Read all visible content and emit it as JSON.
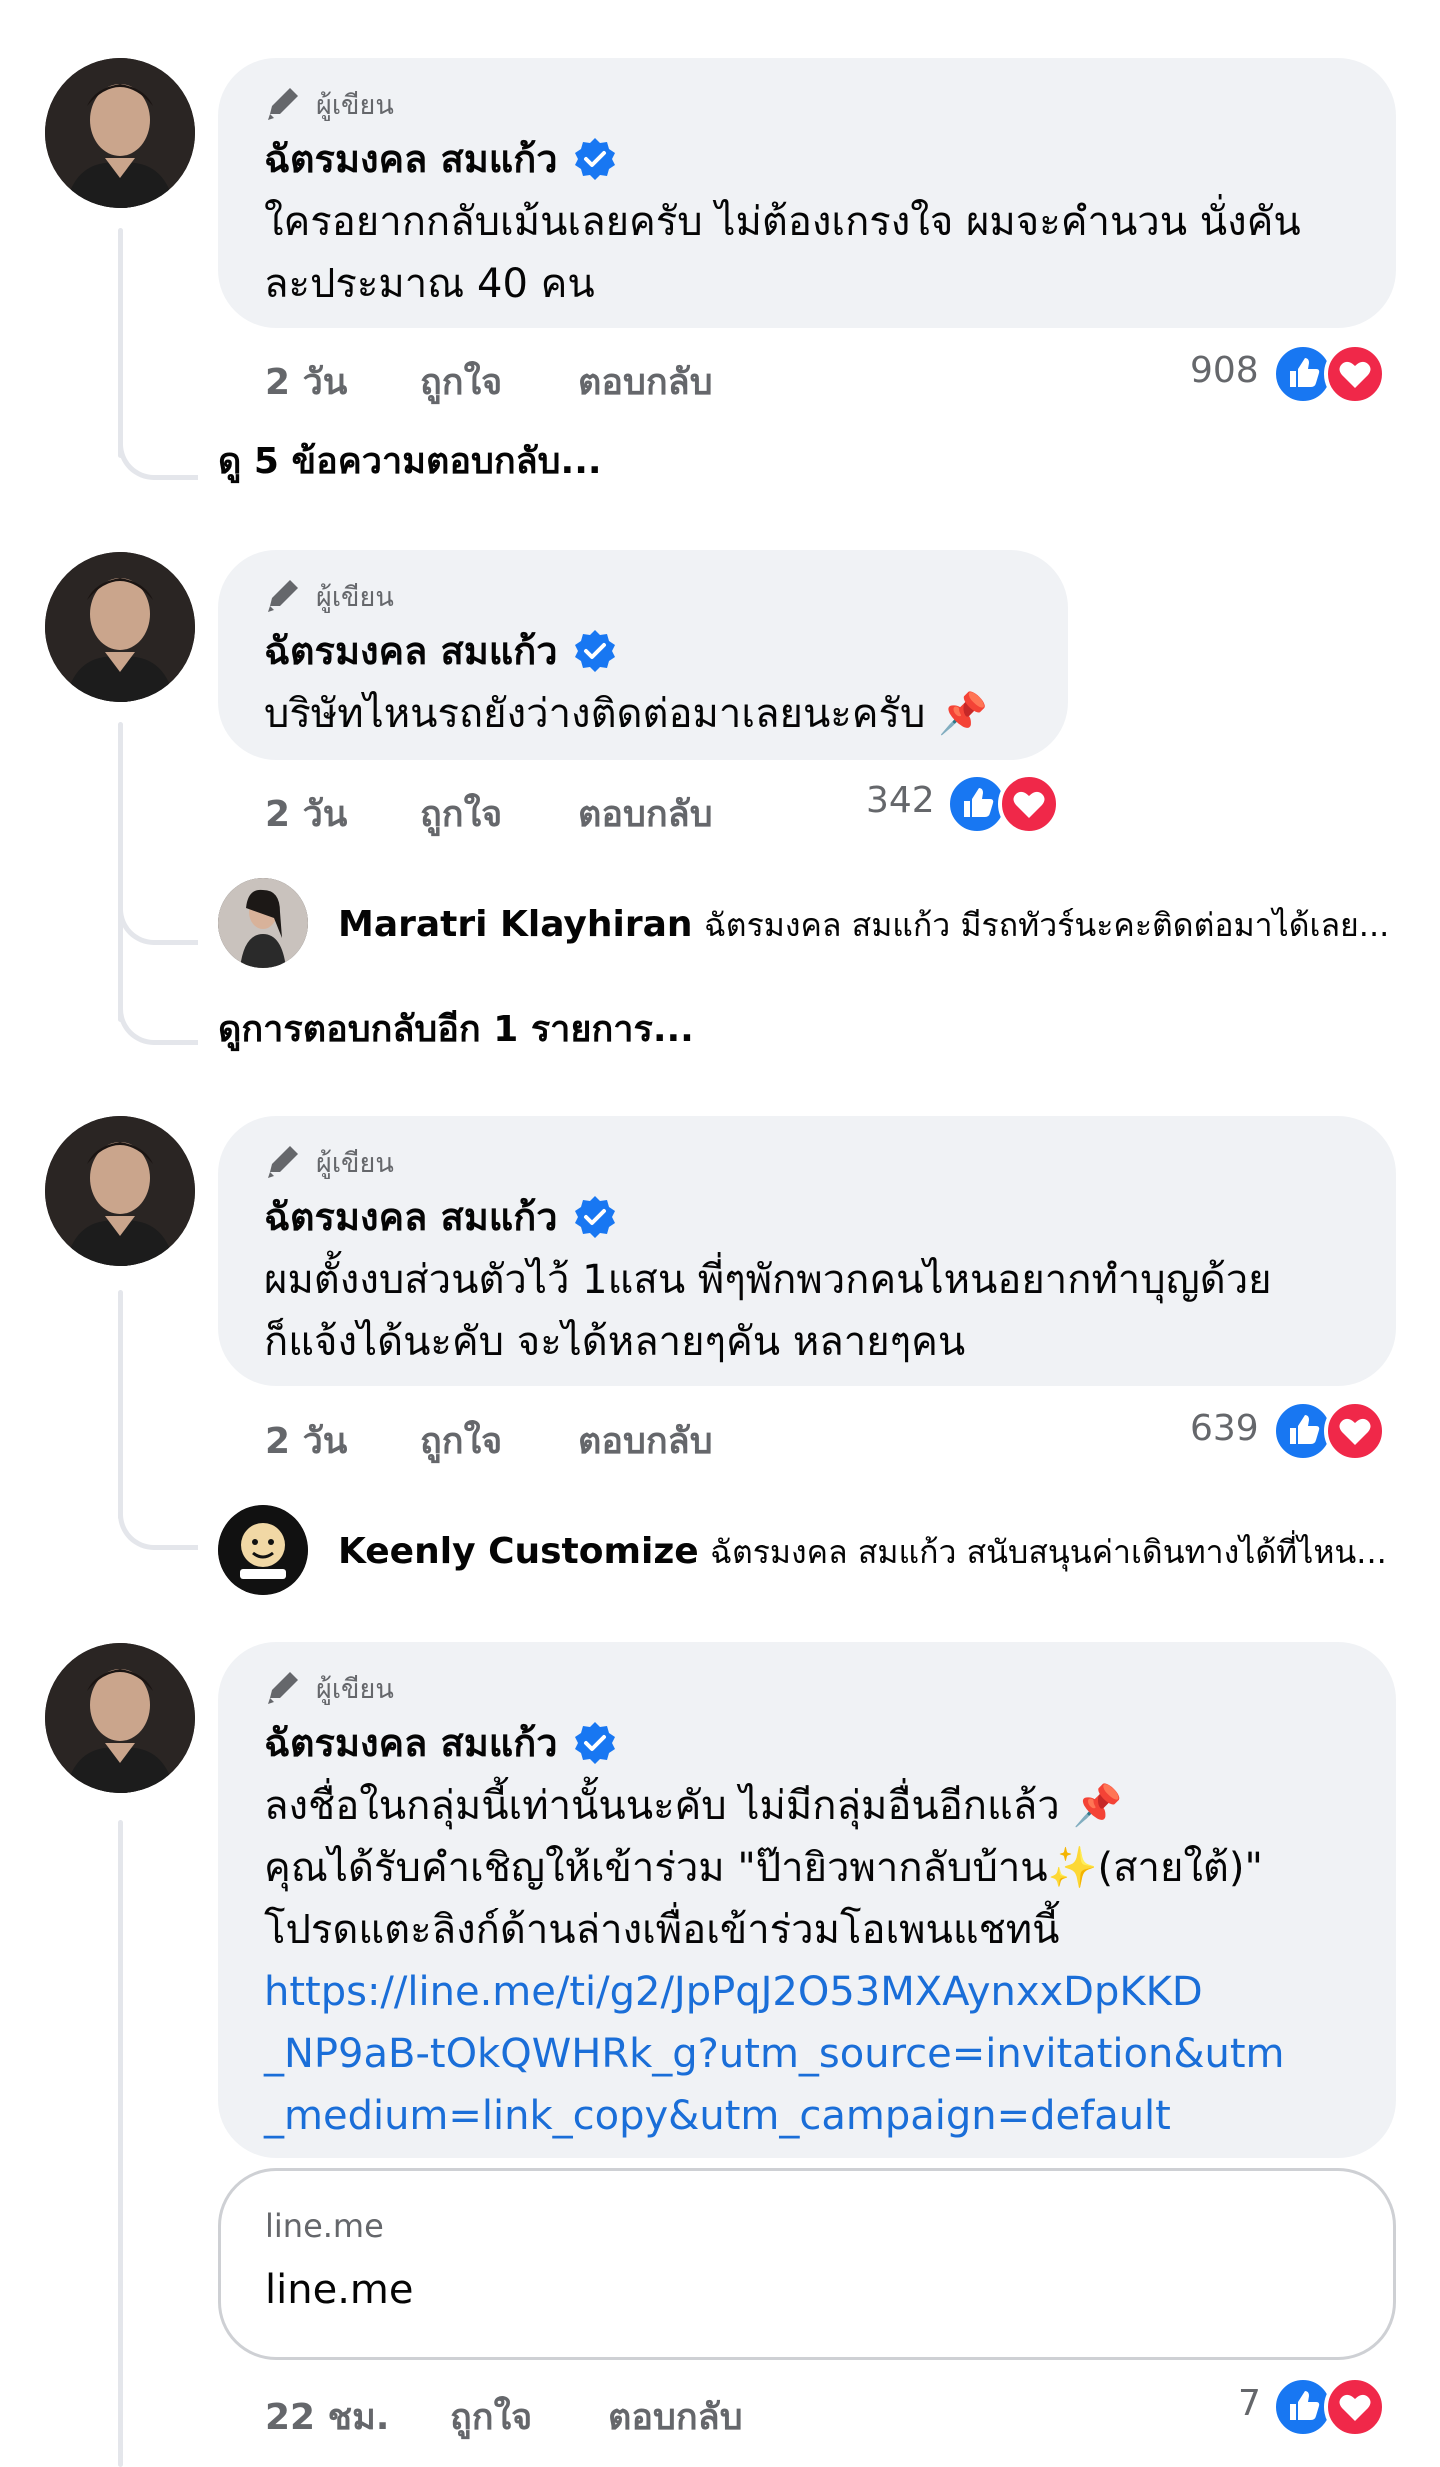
{
  "comments": [
    {
      "badge": "ผู้เขียน",
      "author": "ฉัตรมงคล สมแก้ว",
      "text": "ใครอยากกลับเม้นเลยครับ ไม่ต้องเกรงใจ ผมจะคำนวน นั่งคัน\nละประมาณ 40 คน",
      "time": "2 วัน",
      "like_label": "ถูกใจ",
      "reply_label": "ตอบกลับ",
      "reaction_count": "908",
      "view_more": "ดู 5 ข้อความตอบกลับ..."
    },
    {
      "badge": "ผู้เขียน",
      "author": "ฉัตรมงคล สมแก้ว",
      "text": "บริษัทไหนรถยังว่างติดต่อมาเลยนะครับ 📌",
      "time": "2 วัน",
      "like_label": "ถูกใจ",
      "reply_label": "ตอบกลับ",
      "reaction_count": "342",
      "reply_preview": {
        "name": "Maratri Klayhiran",
        "text": "ฉัตรมงคล สมแก้ว มีรถทัวร์นะคะติดต่อมาได้เลย..."
      },
      "view_more": "ดูการตอบกลับอีก 1 รายการ..."
    },
    {
      "badge": "ผู้เขียน",
      "author": "ฉัตรมงคล สมแก้ว",
      "text": "ผมตั้งงบส่วนตัวไว้ 1แสน พี่ๆพักพวกคนไหนอยากทำบุญด้วย\nก็แจ้งได้นะคับ จะได้หลายๆคัน หลายๆคน",
      "time": "2 วัน",
      "like_label": "ถูกใจ",
      "reply_label": "ตอบกลับ",
      "reaction_count": "639",
      "reply_preview": {
        "name": "Keenly Customize",
        "text": "ฉัตรมงคล สมแก้ว สนับสนุนค่าเดินทางได้ที่ไหน..."
      }
    },
    {
      "badge": "ผู้เขียน",
      "author": "ฉัตรมงคล สมแก้ว",
      "text": "ลงชื่อในกลุ่มนี้เท่านั้นนะคับ ไม่มีกลุ่มอื่นอีกแล้ว 📌\nคุณได้รับคำเชิญให้เข้าร่วม \"ป๊ายิวพากลับบ้าน✨(สายใต้)\"\nโปรดแตะลิงก์ด้านล่างเพื่อเข้าร่วมโอเพนแชทนี้",
      "link": "https://line.me/ti/g2/JpPqJ2O53MXAynxxDpKKD\n_NP9aB-tOkQWHRk_g?utm_source=invitation&utm\n_medium=link_copy&utm_campaign=default",
      "link_preview": {
        "domain": "line.me",
        "title": "line.me"
      },
      "time": "22 ชม.",
      "like_label": "ถูกใจ",
      "reply_label": "ตอบกลับ",
      "reaction_count": "7"
    }
  ],
  "colors": {
    "bubble": "#f0f2f5",
    "link": "#1a6ed8",
    "like": "#1877f2",
    "love": "#f02849",
    "meta": "#65676b"
  }
}
